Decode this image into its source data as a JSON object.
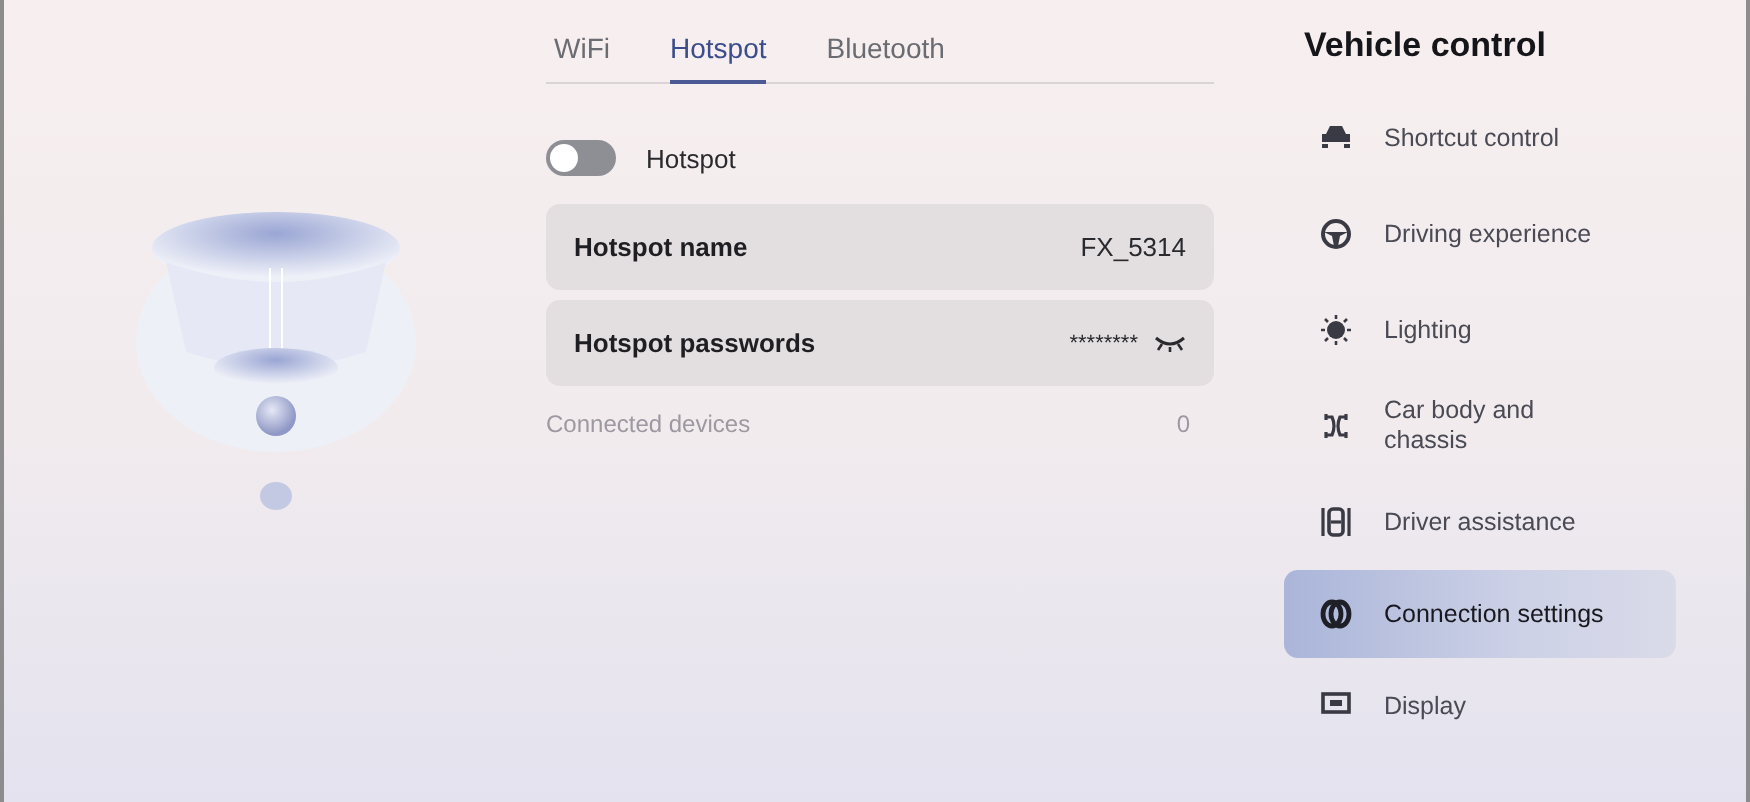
{
  "tabs": [
    {
      "label": "WiFi",
      "selected": false
    },
    {
      "label": "Hotspot",
      "selected": true
    },
    {
      "label": "Bluetooth",
      "selected": false
    }
  ],
  "hotspot_toggle": {
    "label": "Hotspot",
    "on": false
  },
  "settings": [
    {
      "label": "Hotspot name",
      "value": "FX_5314",
      "kind": "text"
    },
    {
      "label": "Hotspot passwords",
      "value": "********",
      "kind": "password"
    }
  ],
  "connected_devices": {
    "label": "Connected devices",
    "value": "0"
  },
  "sidebar": {
    "title": "Vehicle control",
    "items": [
      {
        "label": "Shortcut control",
        "selected": false
      },
      {
        "label": "Driving experience",
        "selected": false
      },
      {
        "label": "Lighting",
        "selected": false
      },
      {
        "label": "Car body and chassis",
        "selected": false
      },
      {
        "label": "Driver assistance",
        "selected": false
      },
      {
        "label": "Connection settings",
        "selected": true
      },
      {
        "label": "Display",
        "selected": false
      }
    ]
  }
}
